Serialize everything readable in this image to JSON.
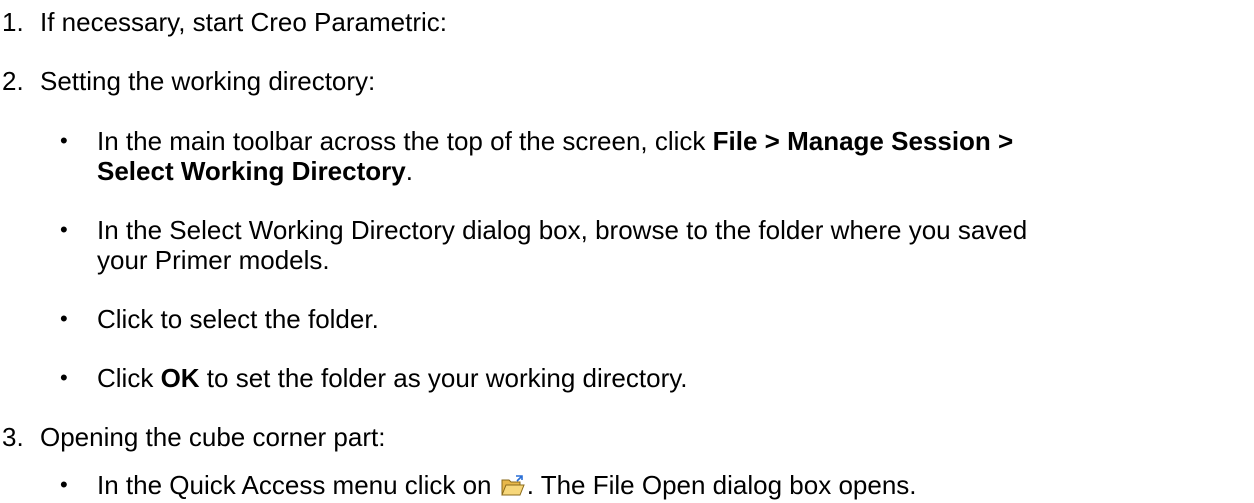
{
  "steps": [
    {
      "number": "1.",
      "text": "If necessary, start Creo Parametric:"
    },
    {
      "number": "2.",
      "text": "Setting the working directory:",
      "bullets": [
        {
          "pre": "In the main toolbar across the top of the screen, click ",
          "bold1": "File > Manage Session >",
          "bold2": "Select Working Directory",
          "post": "."
        },
        {
          "line1": "In the Select Working Directory dialog box, browse to the folder where you saved",
          "line2": "your Primer models."
        },
        {
          "text": "Click to select the folder."
        },
        {
          "pre": "Click ",
          "bold": "OK",
          "post": " to set the folder as your working directory."
        }
      ]
    },
    {
      "number": "3.",
      "text": "Opening the cube corner part:",
      "bullets": [
        {
          "pre": "In the Quick Access menu click on ",
          "icon": "open-folder-icon",
          "post": ".  The File Open dialog box opens."
        }
      ]
    }
  ],
  "bullet_glyph": "•"
}
